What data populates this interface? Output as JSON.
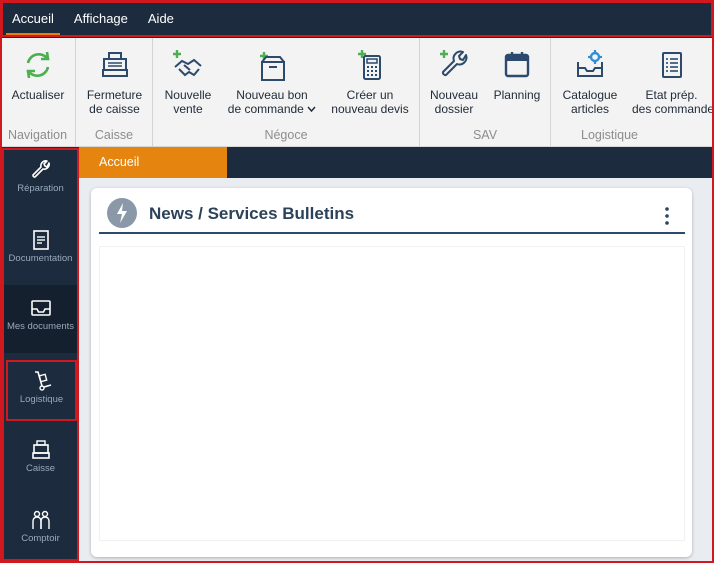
{
  "menubar": {
    "items": [
      {
        "label": "Accueil",
        "active": true
      },
      {
        "label": "Affichage",
        "active": false
      },
      {
        "label": "Aide",
        "active": false
      }
    ]
  },
  "ribbon": {
    "groups": [
      {
        "label": "Navigation",
        "buttons": [
          {
            "line1": "Actualiser",
            "line2": "",
            "icon": "refresh-icon"
          }
        ]
      },
      {
        "label": "Caisse",
        "buttons": [
          {
            "line1": "Fermeture",
            "line2": "de caisse",
            "icon": "cash-register-icon"
          }
        ]
      },
      {
        "label": "Négoce",
        "buttons": [
          {
            "line1": "Nouvelle",
            "line2": "vente",
            "icon": "handshake-plus-icon"
          },
          {
            "line1": "Nouveau bon",
            "line2": "de commande",
            "icon": "box-plus-icon",
            "dropdown": true
          },
          {
            "line1": "Créer un",
            "line2": "nouveau devis",
            "icon": "calculator-plus-icon"
          }
        ]
      },
      {
        "label": "SAV",
        "buttons": [
          {
            "line1": "Nouveau",
            "line2": "dossier",
            "icon": "wrench-plus-icon"
          },
          {
            "line1": "Planning",
            "line2": "",
            "icon": "calendar-icon"
          }
        ]
      },
      {
        "label": "Logistique",
        "buttons": [
          {
            "line1": "Catalogue",
            "line2": "articles",
            "icon": "catalog-gear-icon"
          },
          {
            "line1": "Etat prép.",
            "line2": "des commande",
            "icon": "clipboard-list-icon"
          }
        ]
      }
    ]
  },
  "sidebar": {
    "items": [
      {
        "label": "Réparation",
        "icon": "wrench-icon"
      },
      {
        "label": "Documentation",
        "icon": "document-icon"
      },
      {
        "label": "Mes documents",
        "icon": "inbox-icon"
      },
      {
        "label": "Logistique",
        "icon": "hand-truck-icon"
      },
      {
        "label": "Caisse",
        "icon": "cash-register-icon"
      },
      {
        "label": "Comptoir",
        "icon": "people-icon"
      }
    ]
  },
  "tabs": [
    {
      "label": "Accueil",
      "active": true
    }
  ],
  "card": {
    "title": "News / Services Bulletins",
    "icon": "bolt-icon",
    "menu_icon": "kebab-menu-icon"
  },
  "colors": {
    "navy": "#1c2b3e",
    "accent_orange": "#ef7d00",
    "tab_orange": "#e5850f",
    "green_plus": "#4caf50",
    "icon_blue": "#2c4a6b",
    "highlight_red": "#d0181e"
  }
}
